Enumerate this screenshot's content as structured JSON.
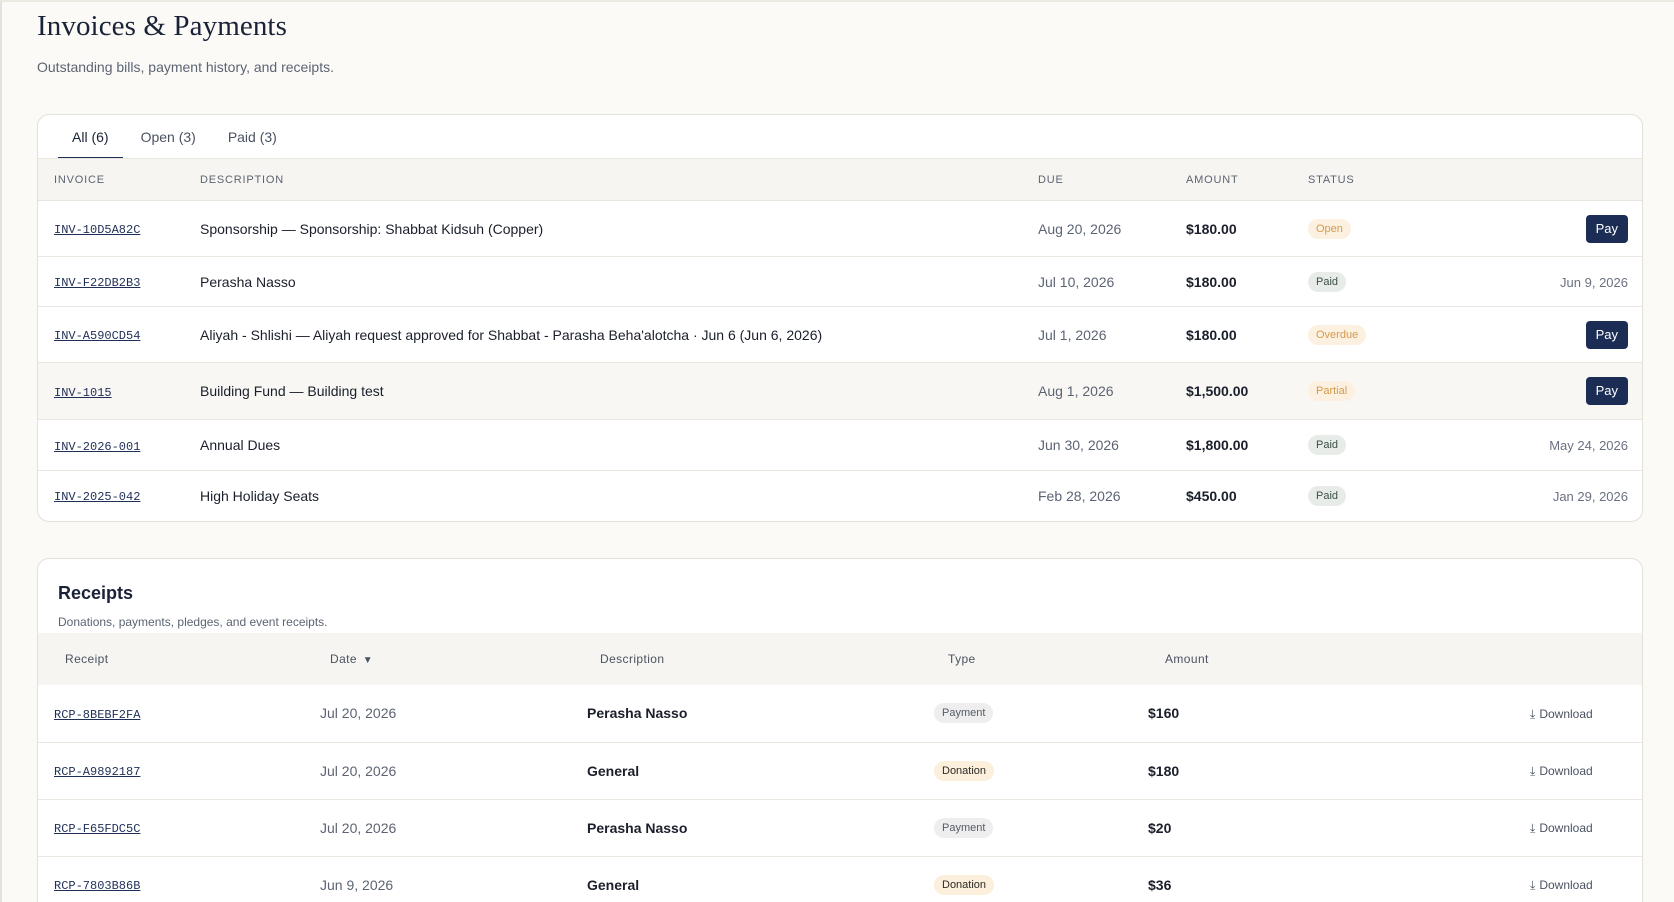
{
  "page": {
    "title": "Invoices & Payments",
    "subtitle": "Outstanding bills, payment history, and receipts."
  },
  "tabs": [
    {
      "label": "All (6)",
      "active": true
    },
    {
      "label": "Open (3)",
      "active": false
    },
    {
      "label": "Paid (3)",
      "active": false
    }
  ],
  "invoices": {
    "headers": {
      "invoice": "INVOICE",
      "description": "DESCRIPTION",
      "due": "DUE",
      "amount": "AMOUNT",
      "status": "STATUS"
    },
    "rows": [
      {
        "id": "INV-10D5A82C",
        "description": "Sponsorship — Sponsorship: Shabbat Kidsuh (Copper)",
        "due": "Aug 20, 2026",
        "amount": "$180.00",
        "status": "Open",
        "action": "Pay",
        "paid_on": ""
      },
      {
        "id": "INV-F22DB2B3",
        "description": "Perasha Nasso",
        "due": "Jul 10, 2026",
        "amount": "$180.00",
        "status": "Paid",
        "action": "",
        "paid_on": "Jun 9, 2026"
      },
      {
        "id": "INV-A590CD54",
        "description": "Aliyah - Shlishi — Aliyah request approved for Shabbat - Parasha Beha'alotcha · Jun 6 (Jun 6, 2026)",
        "due": "Jul 1, 2026",
        "amount": "$180.00",
        "status": "Overdue",
        "action": "Pay",
        "paid_on": ""
      },
      {
        "id": "INV-1015",
        "description": "Building Fund — Building test",
        "due": "Aug 1, 2026",
        "amount": "$1,500.00",
        "status": "Partial",
        "action": "Pay",
        "paid_on": ""
      },
      {
        "id": "INV-2026-001",
        "description": "Annual Dues",
        "due": "Jun 30, 2026",
        "amount": "$1,800.00",
        "status": "Paid",
        "action": "",
        "paid_on": "May 24, 2026"
      },
      {
        "id": "INV-2025-042",
        "description": "High Holiday Seats",
        "due": "Feb 28, 2026",
        "amount": "$450.00",
        "status": "Paid",
        "action": "",
        "paid_on": "Jan 29, 2026"
      }
    ]
  },
  "receipts": {
    "title": "Receipts",
    "subtitle": "Donations, payments, pledges, and event receipts.",
    "headers": {
      "receipt": "Receipt",
      "date": "Date",
      "sort_indicator": "▼",
      "description": "Description",
      "type": "Type",
      "amount": "Amount"
    },
    "download_label": "Download",
    "rows": [
      {
        "id": "RCP-8BEBF2FA",
        "date": "Jul 20, 2026",
        "description": "Perasha Nasso",
        "type": "Payment",
        "amount": "$160"
      },
      {
        "id": "RCP-A9892187",
        "date": "Jul 20, 2026",
        "description": "General",
        "type": "Donation",
        "amount": "$180"
      },
      {
        "id": "RCP-F65FDC5C",
        "date": "Jul 20, 2026",
        "description": "Perasha Nasso",
        "type": "Payment",
        "amount": "$20"
      },
      {
        "id": "RCP-7803B86B",
        "date": "Jun 9, 2026",
        "description": "General",
        "type": "Donation",
        "amount": "$36"
      }
    ]
  },
  "colors": {
    "accent": "#1b2c55",
    "background": "#fbfaf7",
    "warning_badge_bg": "#fcf1e0",
    "warning_badge_text": "#d49a4c"
  },
  "icons": {
    "download": "download-icon",
    "sort": "sort-desc-icon"
  }
}
